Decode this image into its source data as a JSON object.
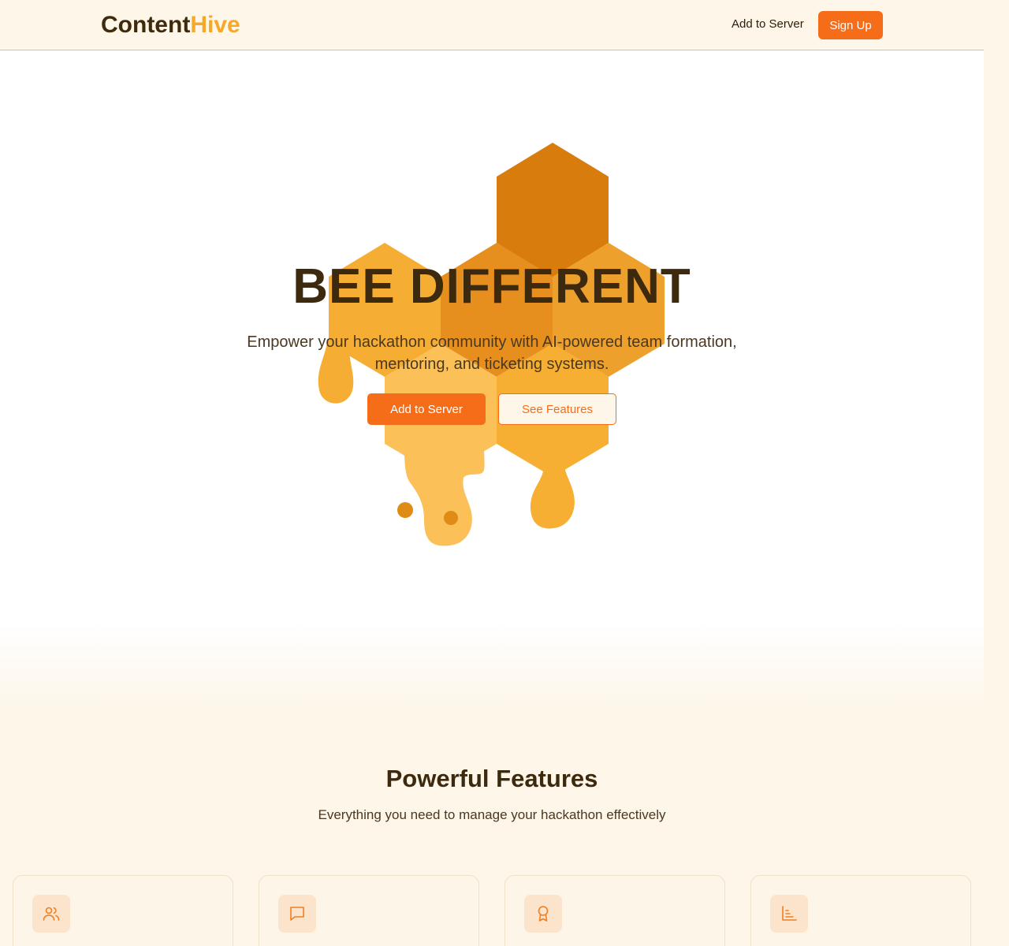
{
  "brand": {
    "name_part1": "Content",
    "name_part2": "Hive"
  },
  "nav": {
    "add_to_server": "Add to Server",
    "sign_up": "Sign Up"
  },
  "hero": {
    "title": "BEE DIFFERENT",
    "subtitle": "Empower your hackathon community with AI-powered team formation, mentoring, and ticketing systems.",
    "primary_button": "Add to Server",
    "secondary_button": "See Features"
  },
  "features": {
    "title": "Powerful Features",
    "subtitle": "Everything you need to manage your hackathon effectively",
    "cards": [
      {
        "icon": "users-icon"
      },
      {
        "icon": "message-icon"
      },
      {
        "icon": "award-icon"
      },
      {
        "icon": "bar-chart-icon"
      }
    ]
  },
  "colors": {
    "accent": "#f66d19",
    "honey_light": "#f6a829",
    "brand_dark": "#3f2a0c",
    "background": "#fdf6e9"
  }
}
